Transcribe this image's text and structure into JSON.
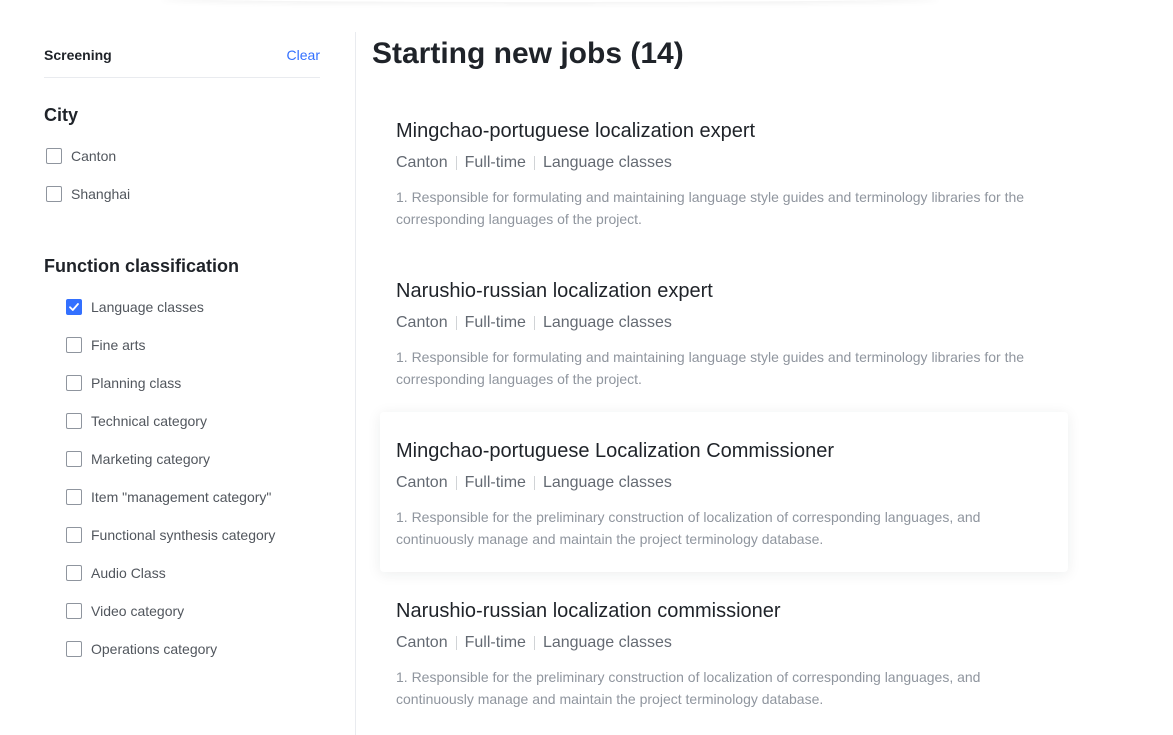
{
  "sidebar": {
    "title": "Screening",
    "clear_label": "Clear",
    "city": {
      "title": "City",
      "options": [
        {
          "label": "Canton",
          "checked": false
        },
        {
          "label": "Shanghai",
          "checked": false
        }
      ]
    },
    "function": {
      "title": "Function classification",
      "options": [
        {
          "label": "Language classes",
          "checked": true
        },
        {
          "label": "Fine arts",
          "checked": false
        },
        {
          "label": "Planning class",
          "checked": false
        },
        {
          "label": "Technical category",
          "checked": false
        },
        {
          "label": "Marketing category",
          "checked": false
        },
        {
          "label": "Item \"management category\"",
          "checked": false
        },
        {
          "label": "Functional synthesis category",
          "checked": false
        },
        {
          "label": "Audio Class",
          "checked": false
        },
        {
          "label": "Video category",
          "checked": false
        },
        {
          "label": "Operations category",
          "checked": false
        }
      ]
    }
  },
  "main": {
    "title": "Starting new jobs (14)",
    "jobs": [
      {
        "title": "Mingchao-portuguese localization expert",
        "city": "Canton",
        "type": "Full-time",
        "category": "Language classes",
        "description": "1. Responsible for formulating and maintaining language style guides and terminology libraries for the corresponding languages of the project."
      },
      {
        "title": "Narushio-russian localization expert",
        "city": "Canton",
        "type": "Full-time",
        "category": "Language classes",
        "description": "1. Responsible for formulating and maintaining language style guides and terminology libraries for the corresponding languages of the project."
      },
      {
        "title": "Mingchao-portuguese Localization Commissioner",
        "city": "Canton",
        "type": "Full-time",
        "category": "Language classes",
        "description": "1. Responsible for the preliminary construction of localization of corresponding languages, and continuously manage and maintain the project terminology database."
      },
      {
        "title": "Narushio-russian localization commissioner",
        "city": "Canton",
        "type": "Full-time",
        "category": "Language classes",
        "description": "1. Responsible for the preliminary construction of localization of corresponding languages, and continuously manage and maintain the project terminology database."
      }
    ]
  },
  "colors": {
    "accent": "#3370ff",
    "text_primary": "#1f2329",
    "text_meta": "#646a73",
    "text_muted": "#8f959e"
  }
}
